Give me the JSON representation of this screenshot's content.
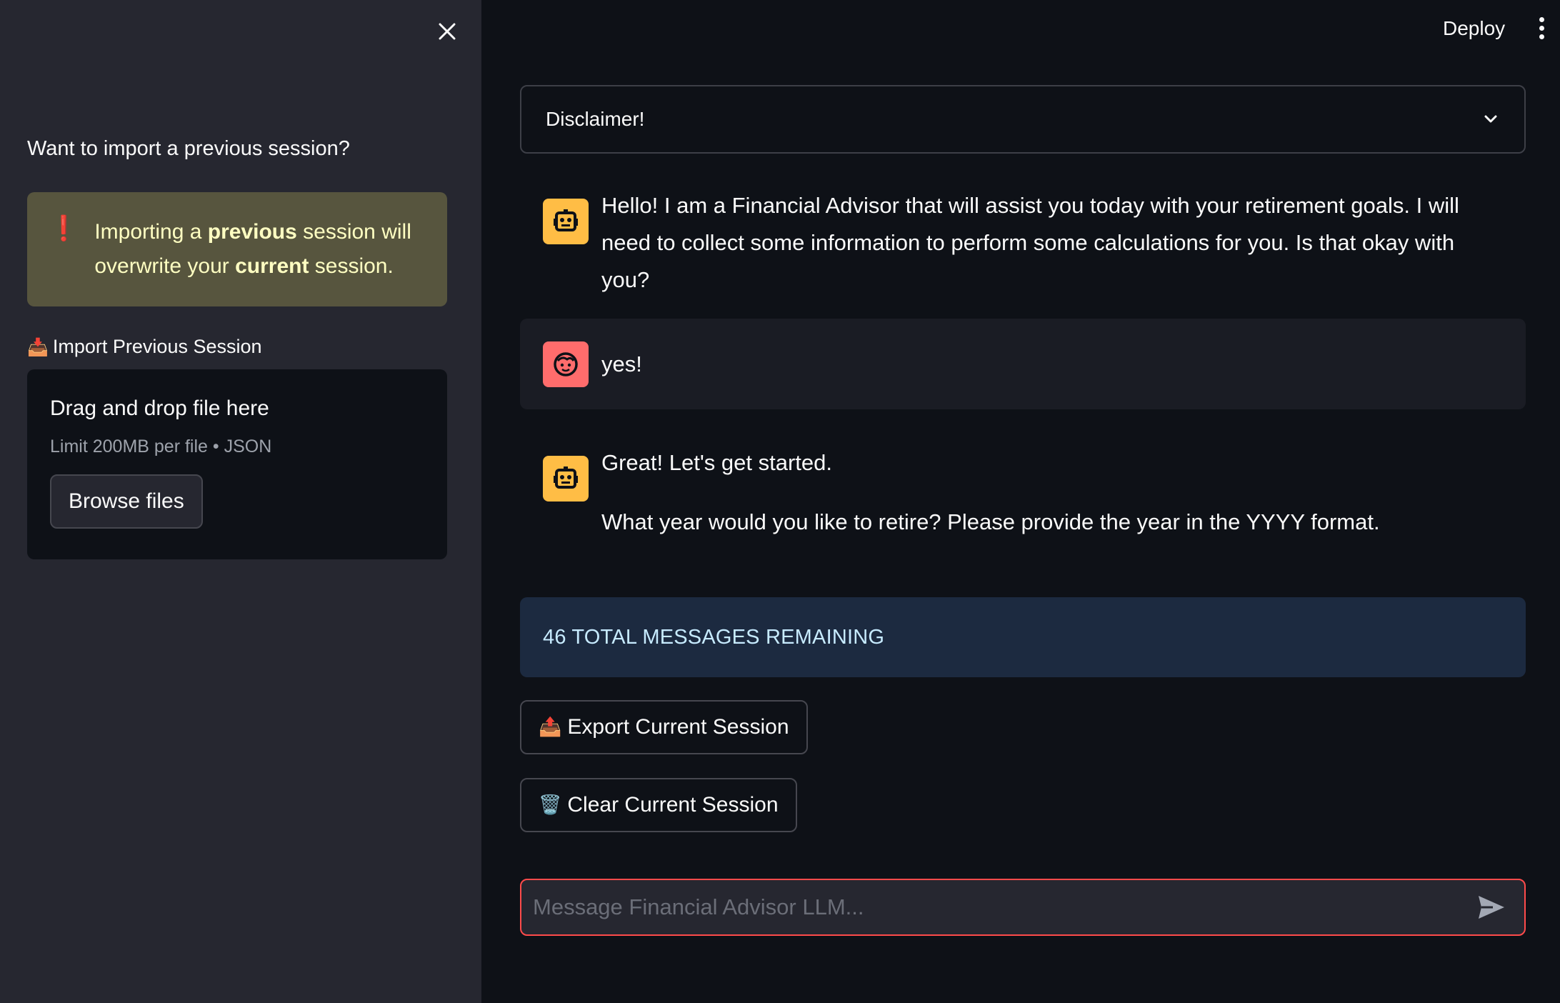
{
  "header": {
    "deploy_label": "Deploy",
    "menu_icon": "kebab-menu-icon"
  },
  "sidebar": {
    "close_icon": "close-icon",
    "heading": "Want to import a previous session?",
    "warning": {
      "icon": "exclamation-icon",
      "part1": "Importing a ",
      "bold1": "previous",
      "part2": " session will overwrite your ",
      "bold2": "current",
      "part3": " session."
    },
    "import_label": "Import Previous Session",
    "import_emoji": "📥",
    "dropzone": {
      "title": "Drag and drop file here",
      "subtitle": "Limit 200MB per file • JSON",
      "button_label": "Browse files"
    }
  },
  "main": {
    "disclaimer_label": "Disclaimer!",
    "messages": [
      {
        "role": "assistant",
        "avatar": "robot-icon",
        "paragraphs": [
          "Hello! I am a Financial Advisor that will assist you today with your retirement goals. I will need to collect some information to perform some calculations for you. Is that okay with you?"
        ]
      },
      {
        "role": "user",
        "avatar": "face-icon",
        "paragraphs": [
          "yes!"
        ]
      },
      {
        "role": "assistant",
        "avatar": "robot-icon",
        "paragraphs": [
          "Great! Let's get started.",
          "What year would you like to retire? Please provide the year in the YYYY format."
        ]
      }
    ],
    "remaining_label": "46 TOTAL MESSAGES REMAINING",
    "export_emoji": "📤",
    "export_label": "Export Current Session",
    "clear_emoji": "🗑️",
    "clear_label": "Clear Current Session",
    "chat_input": {
      "value": "",
      "placeholder": "Message Financial Advisor LLM..."
    }
  },
  "colors": {
    "background": "#0e1117",
    "sidebar": "#262730",
    "warning_bg": "#57553e",
    "info_bg": "#1c2a40",
    "assistant_avatar": "#ffbd45",
    "user_avatar": "#ff6c6c",
    "input_border": "#ff4b4b"
  }
}
